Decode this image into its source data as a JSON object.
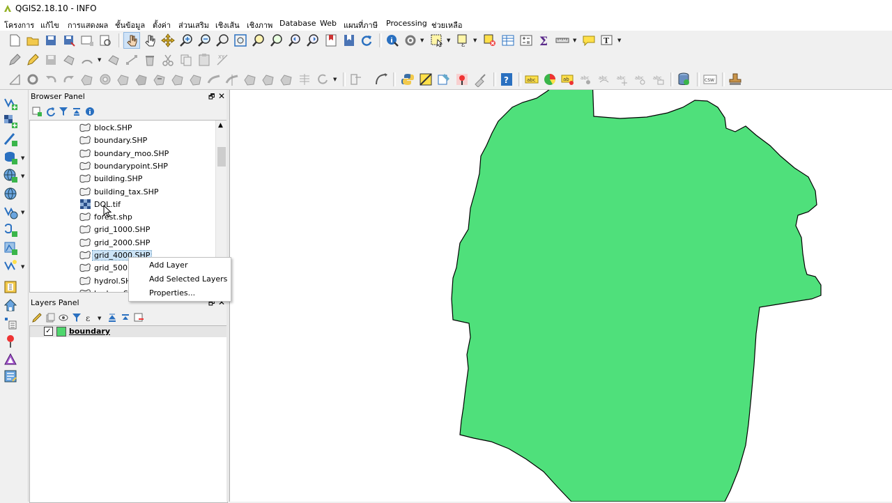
{
  "window": {
    "title": "QGIS2.18.10 - INFO"
  },
  "menu": [
    "โครงการ",
    "แก้ไข",
    "การแสดงผล",
    "ชั้นข้อมูล",
    "ตั้งค่า",
    "ส่วนเสริม",
    "เชิงเส้น",
    "เชิงภาพ",
    "Database",
    "Web",
    "แผนที่ภาษี",
    "Processing",
    "ช่วยเหลือ"
  ],
  "browser_panel": {
    "title": "Browser Panel",
    "float_glyph": "🗗",
    "close_glyph": "✕",
    "items": [
      {
        "label": "block.SHP",
        "type": "vector"
      },
      {
        "label": "boundary.SHP",
        "type": "vector"
      },
      {
        "label": "boundary_moo.SHP",
        "type": "vector"
      },
      {
        "label": "boundarypoint.SHP",
        "type": "vector"
      },
      {
        "label": "building.SHP",
        "type": "vector"
      },
      {
        "label": "building_tax.SHP",
        "type": "vector"
      },
      {
        "label": "DOL.tif",
        "type": "raster"
      },
      {
        "label": "forest.shp",
        "type": "vector"
      },
      {
        "label": "grid_1000.SHP",
        "type": "vector"
      },
      {
        "label": "grid_2000.SHP",
        "type": "vector"
      },
      {
        "label": "grid_4000.SHP",
        "type": "vector",
        "selected": true
      },
      {
        "label": "grid_500.S",
        "type": "vector"
      },
      {
        "label": "hydrol.SHP",
        "type": "vector"
      },
      {
        "label": "hydrop.SHP",
        "type": "vector"
      }
    ]
  },
  "context_menu": {
    "items": [
      "Add Layer",
      "Add Selected Layers",
      "Properties..."
    ]
  },
  "layers_panel": {
    "title": "Layers Panel",
    "float_glyph": "🗗",
    "close_glyph": "✕",
    "layers": [
      {
        "name": "boundary",
        "checked": true,
        "check_glyph": "✓",
        "color": "#4fd66d"
      }
    ]
  },
  "colors": {
    "polygon_fill": "#4fe07b",
    "polygon_stroke": "#000000",
    "selection": "#cce4f7"
  }
}
